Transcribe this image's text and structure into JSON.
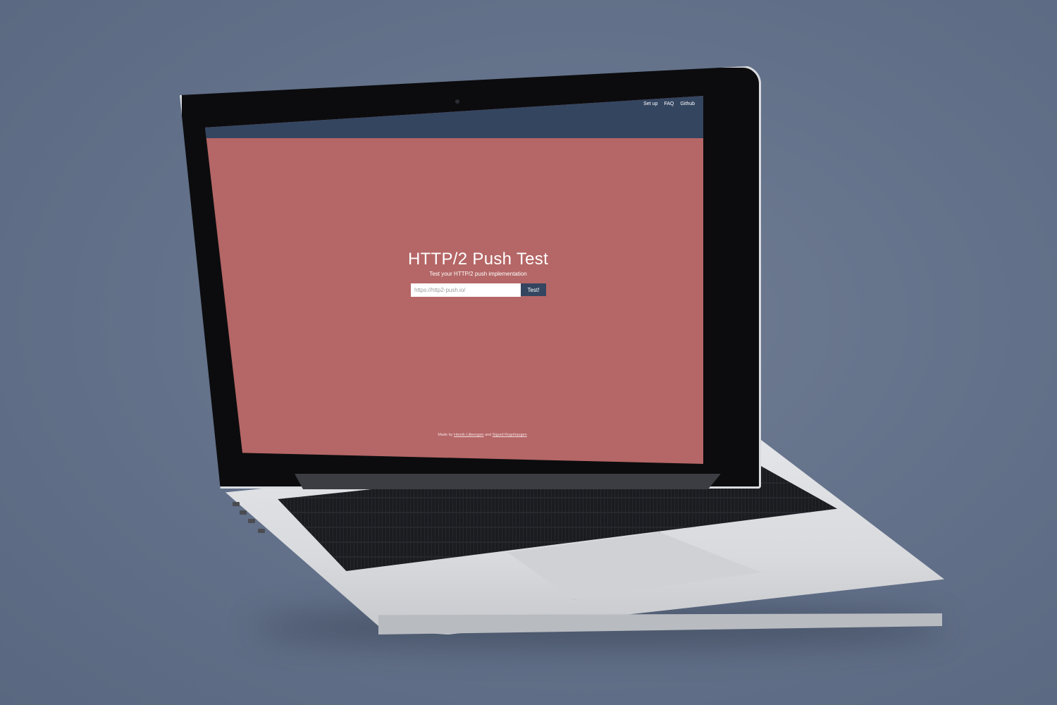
{
  "nav": {
    "links": [
      {
        "label": "Set up"
      },
      {
        "label": "FAQ"
      },
      {
        "label": "Github"
      }
    ]
  },
  "hero": {
    "title": "HTTP/2 Push Test",
    "subtitle": "Test your HTTP/2 push implementation"
  },
  "form": {
    "input_placeholder": "https://http2-push.io/",
    "input_value": "",
    "button_label": "Test!"
  },
  "footer": {
    "prefix": "Made by",
    "author1": "Henrik Lilleengen",
    "joiner": "and",
    "author2": "Sigurd Rognhaugen"
  },
  "colors": {
    "page_background": "#b56666",
    "nav_background": "#344560",
    "button_background": "#344560",
    "backdrop": "#66738a"
  }
}
